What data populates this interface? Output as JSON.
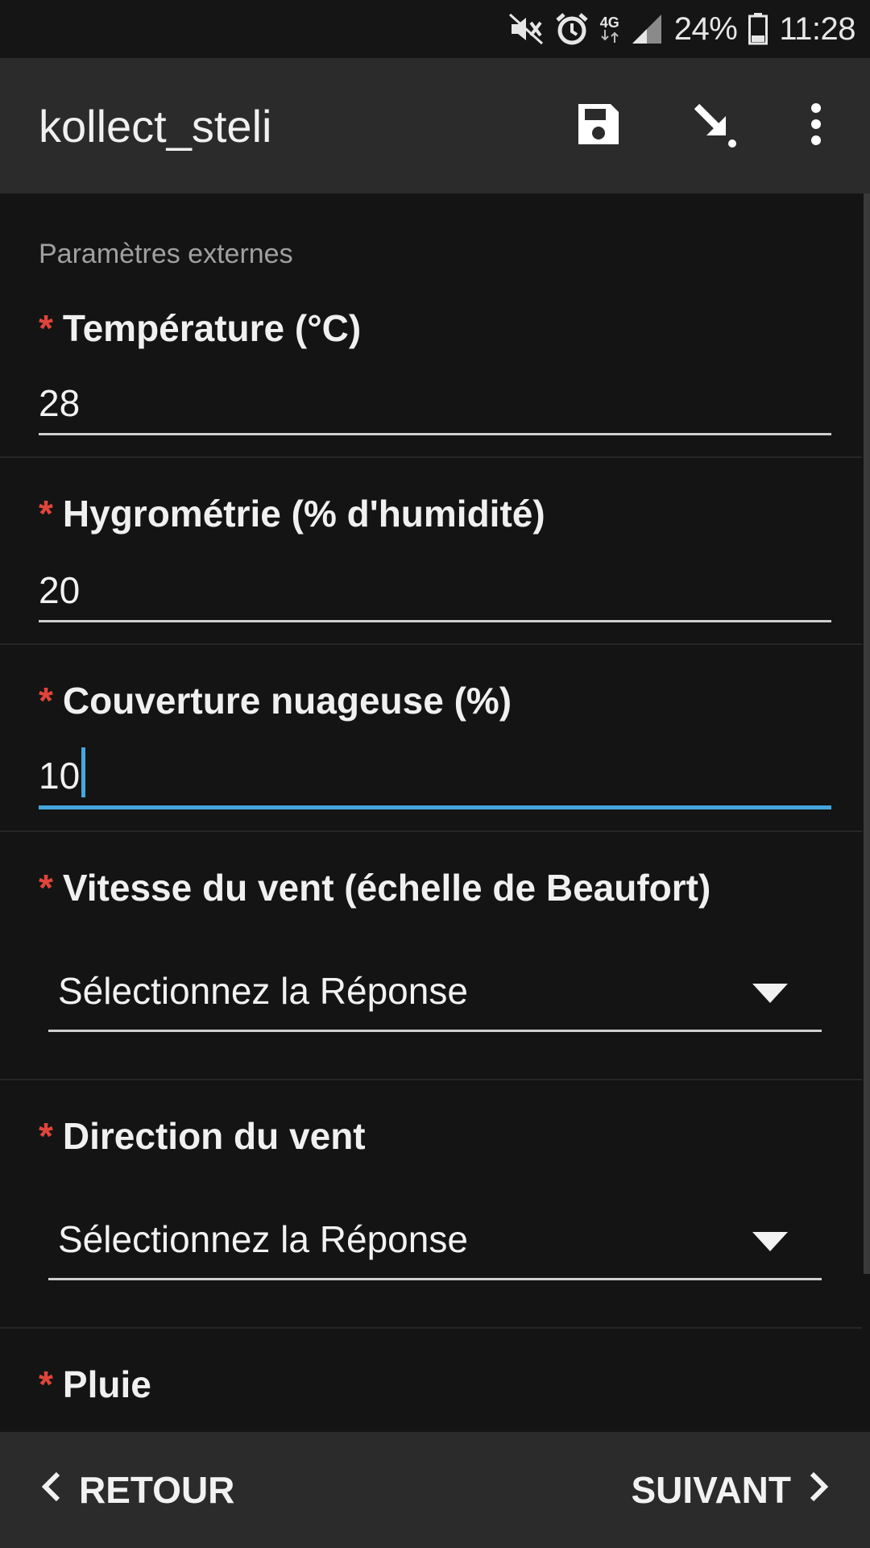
{
  "status_bar": {
    "battery": "24%",
    "time": "11:28",
    "network": "4G",
    "icons": [
      "mute-icon",
      "alarm-icon",
      "network-icon",
      "signal-icon",
      "battery-icon"
    ]
  },
  "app_bar": {
    "title": "kollect_steli",
    "actions": [
      "save-icon",
      "import-icon",
      "more-vert-icon"
    ]
  },
  "form": {
    "section_label": "Paramètres externes",
    "required_marker": "*",
    "questions": [
      {
        "label": "Température (°C)",
        "type": "text",
        "value": "28"
      },
      {
        "label": "Hygrométrie (% d'humidité)",
        "type": "text",
        "value": "20"
      },
      {
        "label": "Couverture nuageuse (%)",
        "type": "text",
        "value": "10",
        "focused": true
      },
      {
        "label": "Vitesse du vent (échelle de Beaufort)",
        "type": "select",
        "value": "Sélectionnez la Réponse"
      },
      {
        "label": "Direction du vent",
        "type": "select",
        "value": "Sélectionnez la Réponse"
      },
      {
        "label": "Pluie",
        "type": "partial"
      }
    ]
  },
  "bottom_nav": {
    "back_label": "RETOUR",
    "next_label": "SUIVANT"
  },
  "colors": {
    "background": "#141414",
    "bar": "#2b2b2b",
    "required": "#e0453a",
    "focus": "#45a6dc"
  }
}
